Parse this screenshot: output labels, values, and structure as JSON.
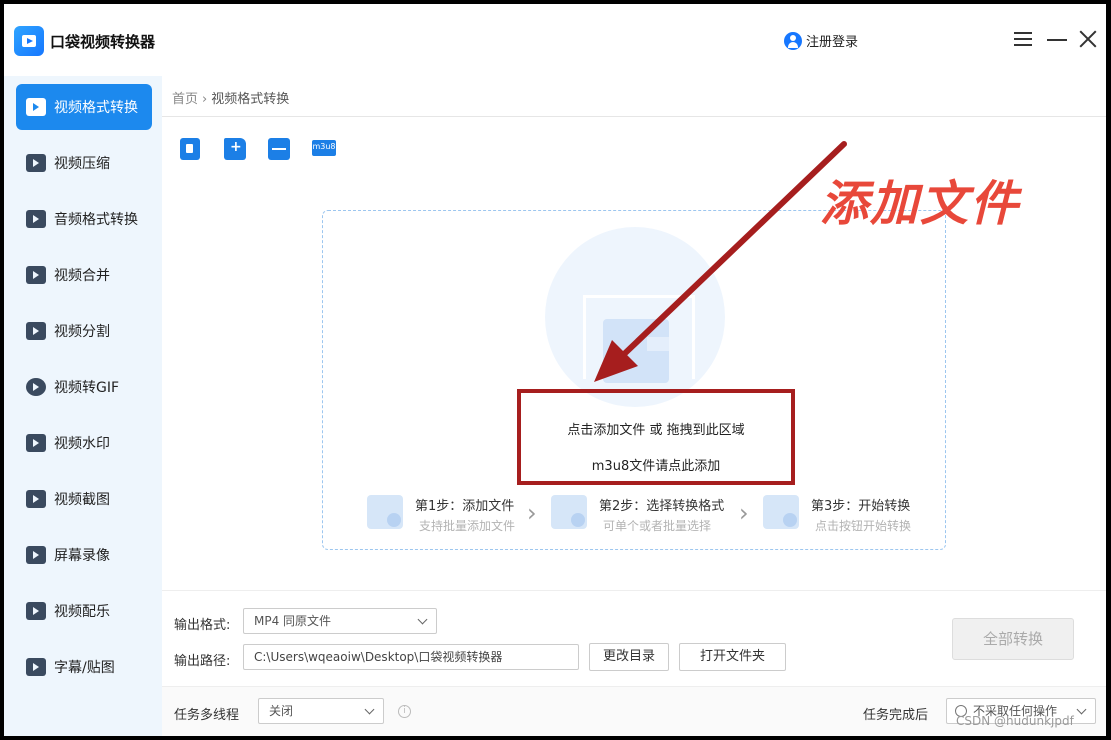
{
  "app": {
    "title": "口袋视频转换器",
    "login_label": "注册登录"
  },
  "sidebar": {
    "items": [
      {
        "label": "视频格式转换",
        "icon": "convert-icon",
        "active": true
      },
      {
        "label": "视频压缩",
        "icon": "compress-icon"
      },
      {
        "label": "音频格式转换",
        "icon": "audio-convert-icon"
      },
      {
        "label": "视频合并",
        "icon": "merge-icon"
      },
      {
        "label": "视频分割",
        "icon": "split-icon"
      },
      {
        "label": "视频转GIF",
        "icon": "gif-icon"
      },
      {
        "label": "视频水印",
        "icon": "watermark-icon"
      },
      {
        "label": "视频截图",
        "icon": "screenshot-icon"
      },
      {
        "label": "屏幕录像",
        "icon": "screen-record-icon"
      },
      {
        "label": "视频配乐",
        "icon": "music-icon"
      },
      {
        "label": "字幕/贴图",
        "icon": "subtitle-icon"
      }
    ]
  },
  "breadcrumb": {
    "home": "首页",
    "current": "视频格式转换"
  },
  "toolbar": {
    "m3u8_label": "m3u8"
  },
  "annotation": {
    "text": "添加文件"
  },
  "dropzone": {
    "hint_primary": "点击添加文件 或 拖拽到此区域",
    "hint_m3u8": "m3u8文件请点此添加",
    "steps": [
      {
        "title": "第1步：添加文件",
        "desc": "支持批量添加文件"
      },
      {
        "title": "第2步：选择转换格式",
        "desc": "可单个或者批量选择"
      },
      {
        "title": "第3步：开始转换",
        "desc": "点击按钮开始转换"
      }
    ]
  },
  "output": {
    "format_label": "输出格式:",
    "format_value": "MP4  同原文件",
    "path_label": "输出路径:",
    "path_value": "C:\\Users\\wqeaoiw\\Desktop\\口袋视频转换器",
    "change_dir": "更改目录",
    "open_folder": "打开文件夹",
    "convert_all": "全部转换"
  },
  "footer": {
    "multithread_label": "任务多线程",
    "multithread_value": "关闭",
    "after_done_label": "任务完成后",
    "after_done_value": "不采取任何操作"
  },
  "watermark": "CSDN @hudunkjpdf",
  "colors": {
    "accent": "#1c89ee",
    "annotation": "#e8483a",
    "annotation_box": "#a61e1e"
  }
}
